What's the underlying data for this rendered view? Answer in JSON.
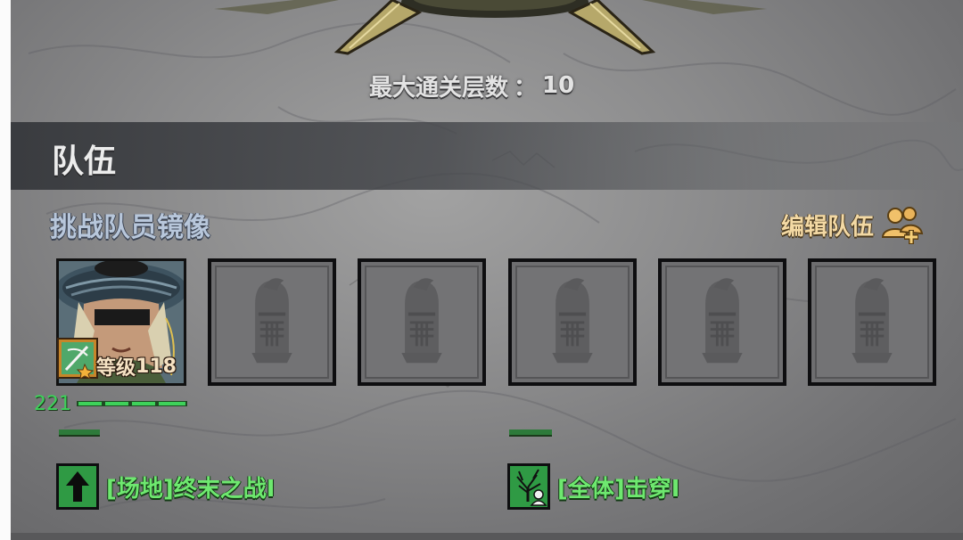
{
  "header": {
    "max_floor_label": "最大通关层数",
    "separator": "：",
    "max_floor_value": "10"
  },
  "team": {
    "title": "队伍",
    "mirror_title": "挑战队员镜像",
    "edit_label": "编辑队伍"
  },
  "hero": {
    "level_label": "等级",
    "level_value": "118",
    "power": "221"
  },
  "empty_slot_icon": "knight-helmet-icon",
  "skills": [
    {
      "label": "[场地]终末之战I",
      "icon": "up-arrow-icon"
    },
    {
      "label": "[全体]击穿I",
      "icon": "tree-figure-icon"
    }
  ],
  "colors": {
    "skill_text": "#6ee86f",
    "mirror_title": "#b8c7db",
    "edit_label": "#f3d9a4",
    "power": "#3ed25a"
  }
}
